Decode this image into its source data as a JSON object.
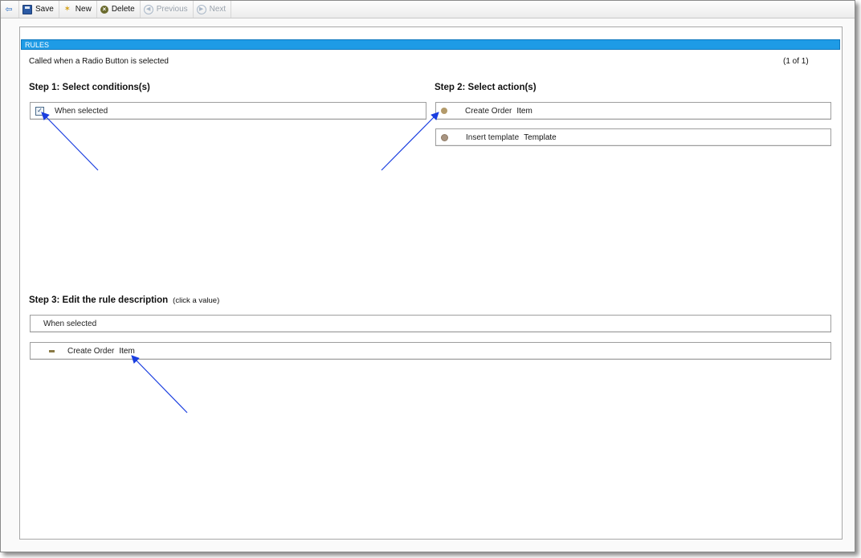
{
  "toolbar": {
    "save_label": "Save",
    "new_label": "New",
    "delete_label": "Delete",
    "previous_label": "Previous",
    "next_label": "Next"
  },
  "rules": {
    "header": "RULES",
    "title": "Called when a Radio Button is selected",
    "count": "(1 of 1)"
  },
  "step1": {
    "title": "Step 1: Select conditions(s)",
    "conditions": [
      {
        "label": "When selected",
        "checked": true
      }
    ]
  },
  "step2": {
    "title": "Step 2: Select action(s)",
    "actions": [
      {
        "label": "Create Order",
        "value": "Item"
      },
      {
        "label": "Insert template",
        "value": "Template"
      }
    ]
  },
  "step3": {
    "title": "Step 3: Edit the rule description",
    "hint": "(click a value)",
    "condition_text": "When selected",
    "action": {
      "label": "Create Order",
      "value": "Item"
    }
  },
  "colors": {
    "header_bg": "#1e9be6",
    "arrow": "#1a3ee0"
  }
}
